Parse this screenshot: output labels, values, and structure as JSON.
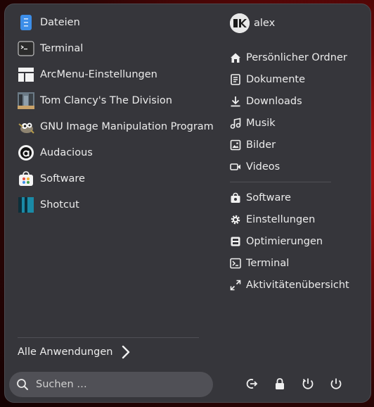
{
  "apps": [
    {
      "label": "Dateien",
      "icon": "files-icon"
    },
    {
      "label": "Terminal",
      "icon": "terminal-icon"
    },
    {
      "label": "ArcMenu-Einstellungen",
      "icon": "arcmenu-icon"
    },
    {
      "label": "Tom Clancy's The Division",
      "icon": "game-icon"
    },
    {
      "label": "GNU Image Manipulation Program",
      "icon": "gimp-icon"
    },
    {
      "label": "Audacious",
      "icon": "audacious-icon"
    },
    {
      "label": "Software",
      "icon": "software-icon"
    },
    {
      "label": "Shotcut",
      "icon": "shotcut-icon"
    }
  ],
  "all_apps_label": "Alle Anwendungen",
  "search": {
    "placeholder": "Suchen …"
  },
  "user": {
    "name": "alex"
  },
  "places": [
    {
      "label": "Persönlicher Ordner",
      "icon": "home-icon"
    },
    {
      "label": "Dokumente",
      "icon": "document-icon"
    },
    {
      "label": "Downloads",
      "icon": "download-icon"
    },
    {
      "label": "Musik",
      "icon": "music-icon"
    },
    {
      "label": "Bilder",
      "icon": "image-icon"
    },
    {
      "label": "Videos",
      "icon": "video-icon"
    }
  ],
  "system": [
    {
      "label": "Software",
      "icon": "software-store-icon"
    },
    {
      "label": "Einstellungen",
      "icon": "settings-icon"
    },
    {
      "label": "Optimierungen",
      "icon": "tweaks-icon"
    },
    {
      "label": "Terminal",
      "icon": "terminal-icon"
    },
    {
      "label": "Aktivitätenübersicht",
      "icon": "activities-icon"
    }
  ],
  "power": [
    "logout-icon",
    "lock-icon",
    "restart-icon",
    "power-icon"
  ]
}
